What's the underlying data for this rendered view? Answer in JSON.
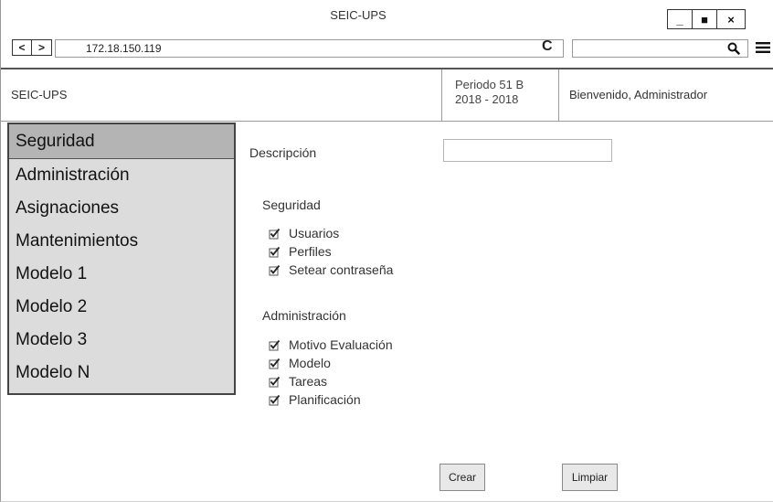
{
  "window": {
    "title": "SEIC-UPS",
    "minimize_glyph": "_",
    "restore_glyph": "■",
    "close_glyph": "×"
  },
  "browser": {
    "back_glyph": "<",
    "forward_glyph": ">",
    "address": "172.18.150.119",
    "reload_glyph": "C",
    "search_value": "",
    "icons": {
      "back": "chevron-left-icon",
      "forward": "chevron-right-icon",
      "reload": "reload-icon",
      "search": "search-icon",
      "menu": "hamburger-menu-icon"
    }
  },
  "header": {
    "app_name": "SEIC-UPS",
    "period_line1": "Periodo 51 B",
    "period_line2": "2018 - 2018",
    "welcome": "Bienvenido, Administrador"
  },
  "sidebar": {
    "items": [
      {
        "label": "Seguridad",
        "selected": true
      },
      {
        "label": "Administración"
      },
      {
        "label": "Asignaciones"
      },
      {
        "label": "Mantenimientos"
      },
      {
        "label": "Modelo 1"
      },
      {
        "label": "Modelo 2"
      },
      {
        "label": "Modelo 3"
      },
      {
        "label": "Modelo N"
      }
    ]
  },
  "form": {
    "description_label": "Descripción",
    "description_value": "",
    "groups": [
      {
        "title": "Seguridad",
        "items": [
          {
            "label": "Usuarios",
            "checked": true
          },
          {
            "label": "Perfiles",
            "checked": true
          },
          {
            "label": "Setear contraseña",
            "checked": true
          }
        ]
      },
      {
        "title": "Administración",
        "items": [
          {
            "label": "Motivo Evaluación",
            "checked": true
          },
          {
            "label": "Modelo",
            "checked": true
          },
          {
            "label": "Tareas",
            "checked": true
          },
          {
            "label": "Planificación",
            "checked": true
          }
        ]
      }
    ],
    "create_label": "Crear",
    "clear_label": "Limpiar"
  }
}
